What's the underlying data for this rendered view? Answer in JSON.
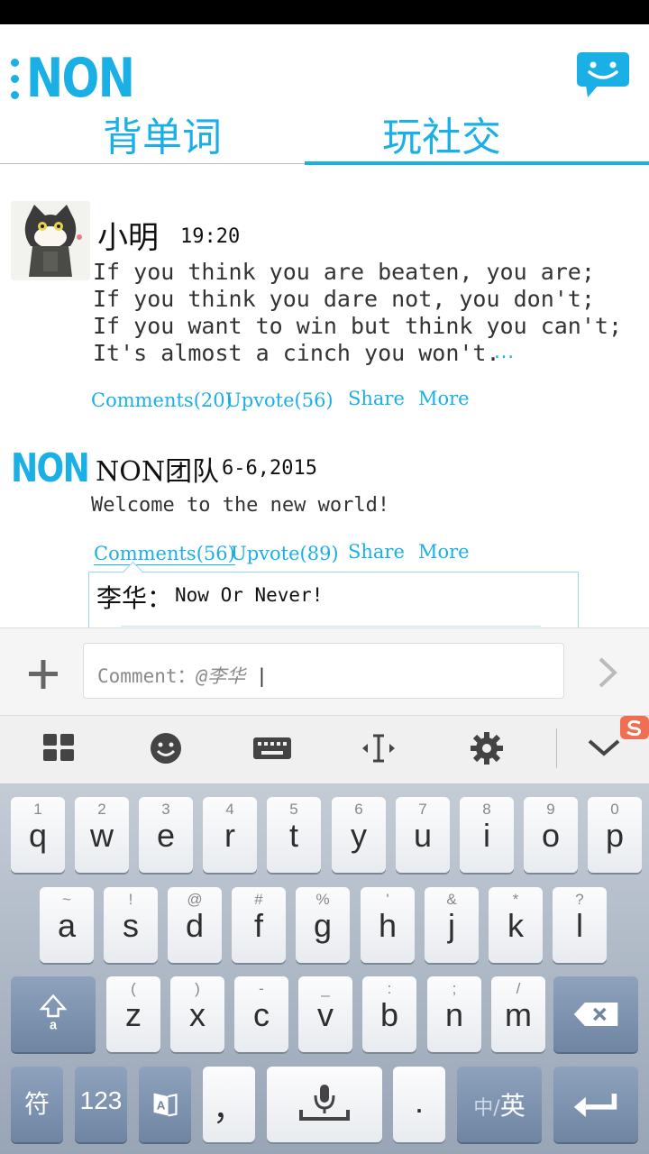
{
  "app": {
    "logo_text": "NON"
  },
  "tabs": [
    {
      "label": "背单词",
      "active": false
    },
    {
      "label": "玩社交",
      "active": true
    }
  ],
  "colors": {
    "accent": "#1ab0e6",
    "keyboard_bg": "#a8b4c4"
  },
  "posts": [
    {
      "user": "小明",
      "time": "19:20",
      "avatar": "cat-avatar",
      "body": "If you think you are beaten, you are;\nIf you think you dare not, you don't;\nIf you want to win but think you can't;\nIt's almost a cinch you won't.",
      "more_indicator": "…",
      "actions": {
        "comments": "Comments(20)",
        "upvote": "Upvote(56)",
        "share": "Share",
        "more": "More"
      }
    },
    {
      "user": "NON团队",
      "time": "6-6,2015",
      "avatar_text": "NON",
      "body": "Welcome to the new world!",
      "actions": {
        "comments": "Comments(56)",
        "upvote": "Upvote(89)",
        "share": "Share",
        "more": "More"
      },
      "reply": {
        "name": "李华：",
        "text": "Now Or Never!"
      }
    }
  ],
  "comment_input": {
    "label": "Comment：",
    "mention": "@李华"
  },
  "keyboard": {
    "toolbar": [
      "grid-icon",
      "emoji-icon",
      "keyboard-icon",
      "cursor-icon",
      "settings-icon",
      "collapse-icon"
    ],
    "row1": [
      {
        "k": "q",
        "h": "1"
      },
      {
        "k": "w",
        "h": "2"
      },
      {
        "k": "e",
        "h": "3"
      },
      {
        "k": "r",
        "h": "4"
      },
      {
        "k": "t",
        "h": "5"
      },
      {
        "k": "y",
        "h": "6"
      },
      {
        "k": "u",
        "h": "7"
      },
      {
        "k": "i",
        "h": "8"
      },
      {
        "k": "o",
        "h": "9"
      },
      {
        "k": "p",
        "h": "0"
      }
    ],
    "row2": [
      {
        "k": "a",
        "h": "~"
      },
      {
        "k": "s",
        "h": "!"
      },
      {
        "k": "d",
        "h": "@"
      },
      {
        "k": "f",
        "h": "#"
      },
      {
        "k": "g",
        "h": "%"
      },
      {
        "k": "h",
        "h": "'"
      },
      {
        "k": "j",
        "h": "&"
      },
      {
        "k": "k",
        "h": "*"
      },
      {
        "k": "l",
        "h": "?"
      }
    ],
    "row3": [
      {
        "k": "z",
        "h": "("
      },
      {
        "k": "x",
        "h": ")"
      },
      {
        "k": "c",
        "h": "-"
      },
      {
        "k": "v",
        "h": "_"
      },
      {
        "k": "b",
        "h": ":"
      },
      {
        "k": "n",
        "h": ";"
      },
      {
        "k": "m",
        "h": "/"
      }
    ],
    "row4": {
      "sym": "符",
      "num": "123",
      "comma": "，",
      "period": ".",
      "lang_cn": "中/",
      "lang_en": "英"
    }
  }
}
